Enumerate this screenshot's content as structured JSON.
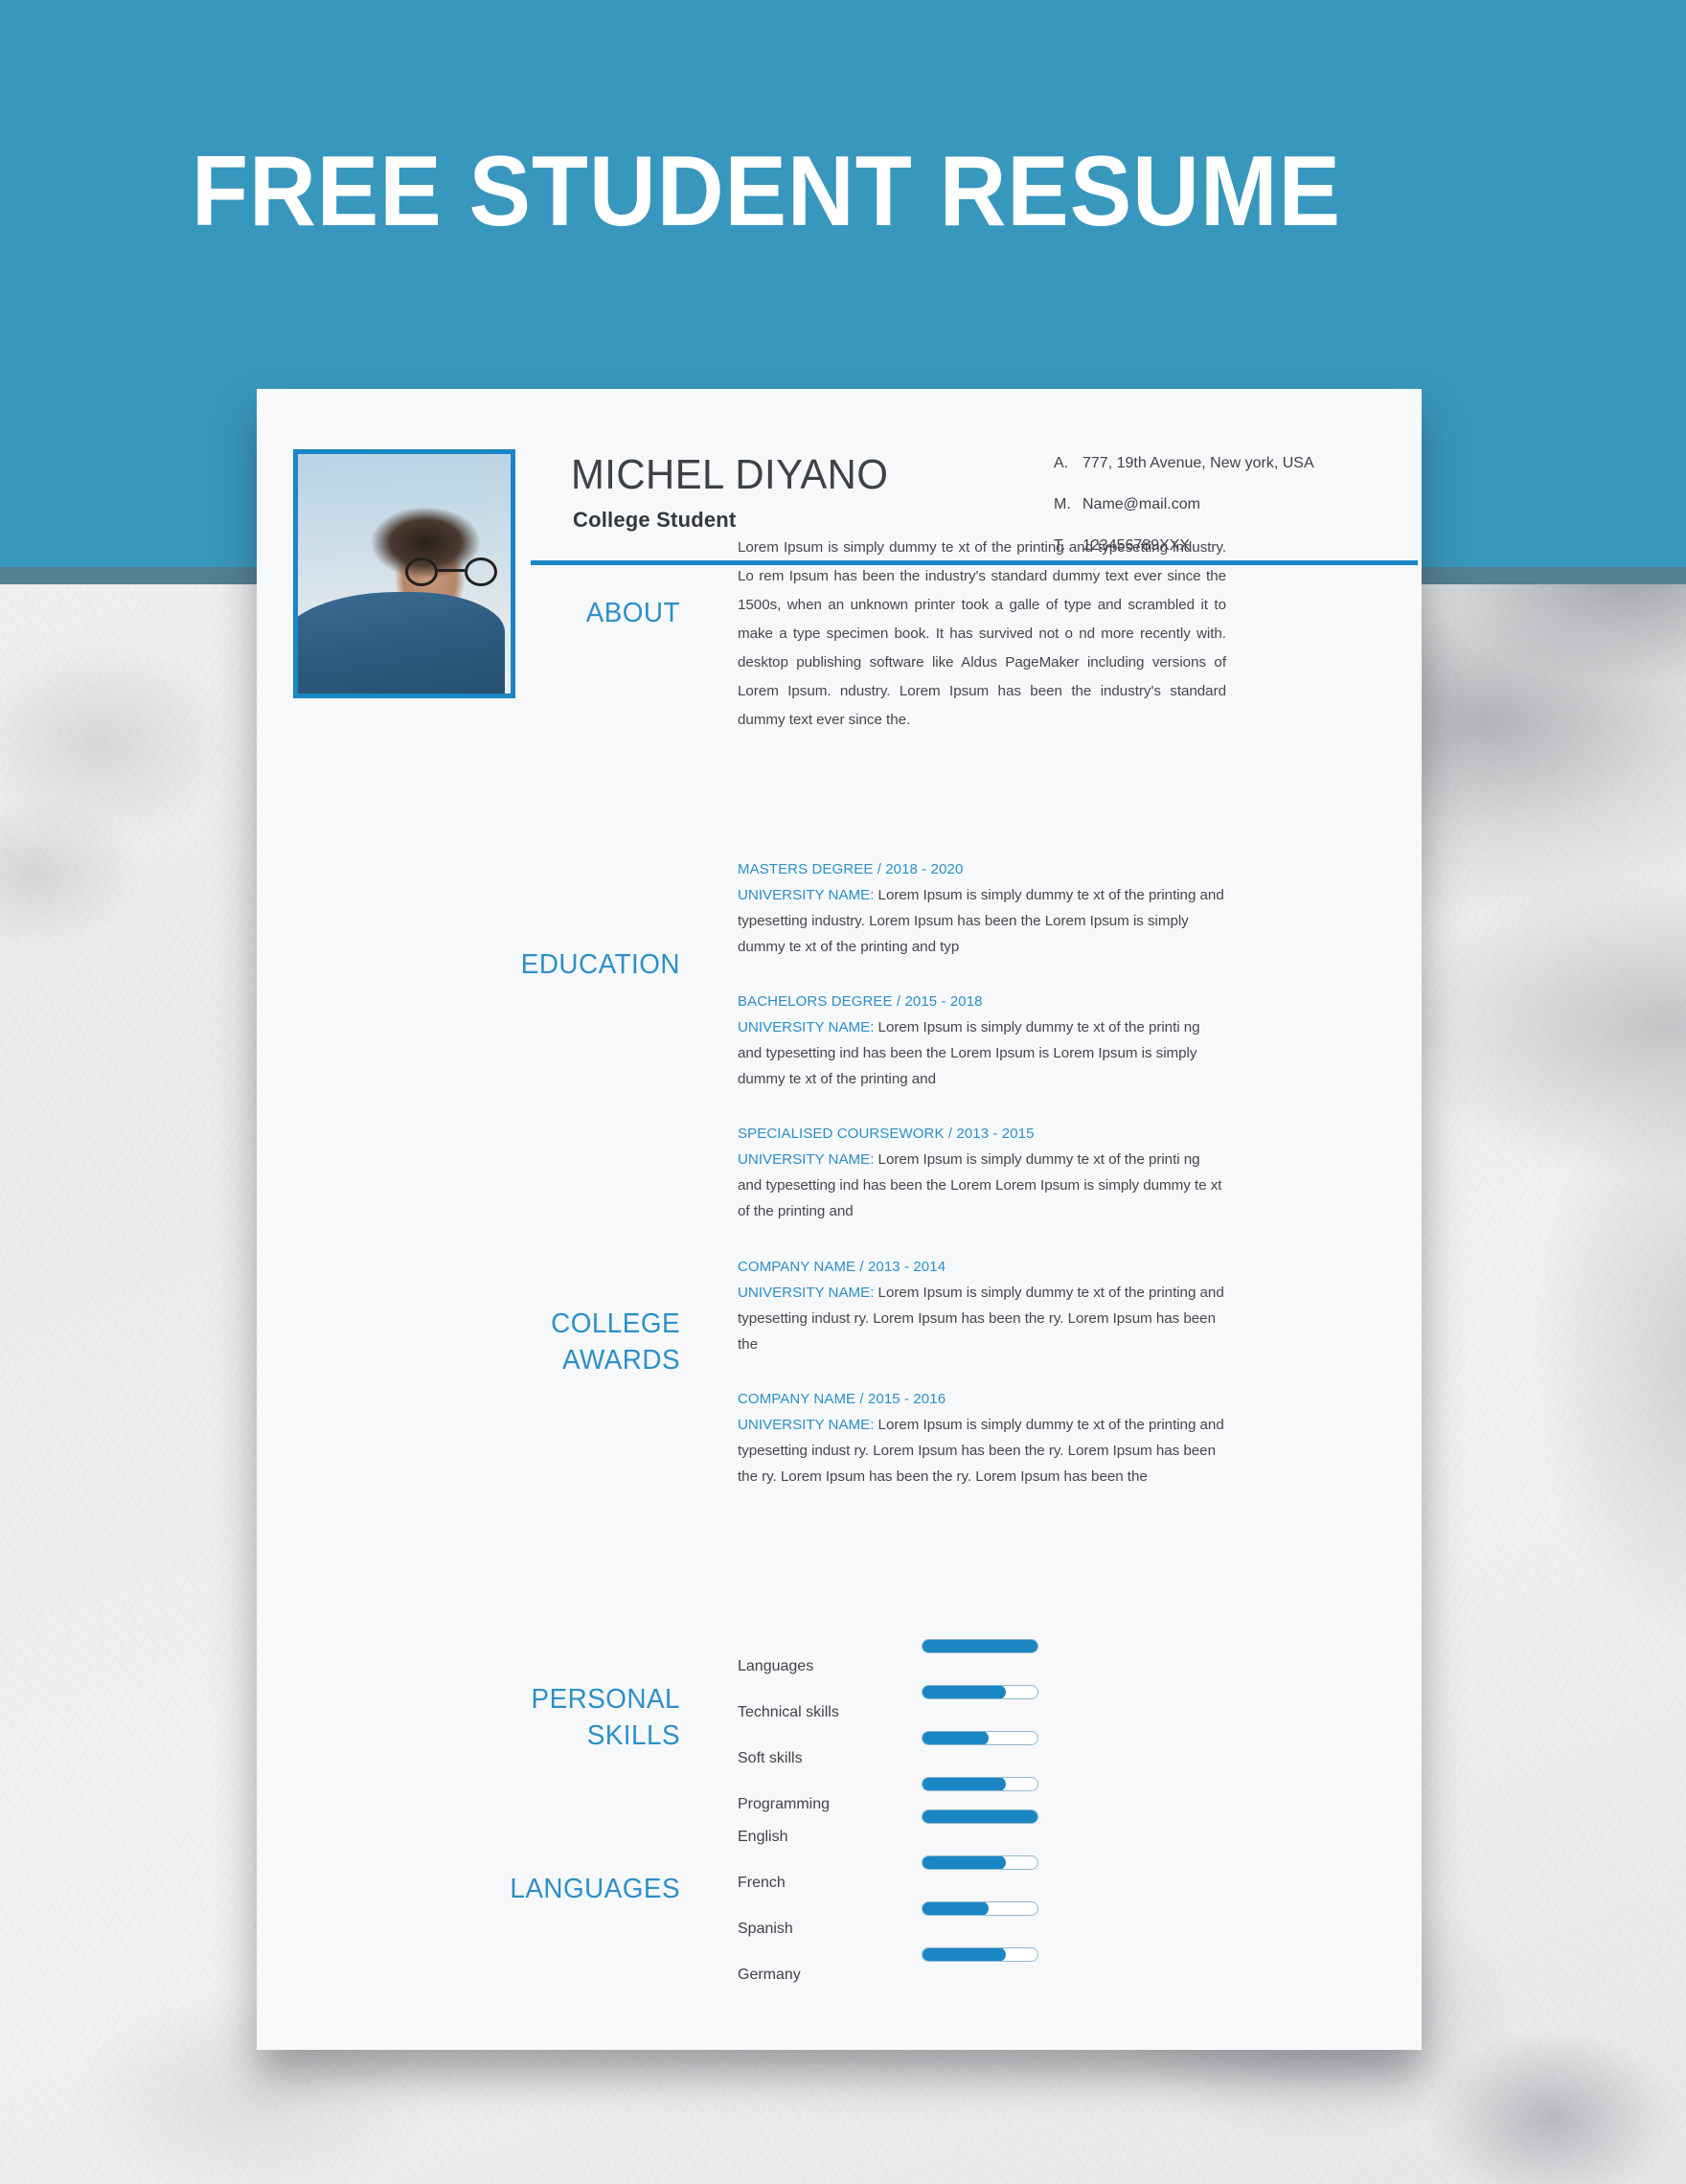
{
  "banner": {
    "title": "FREE STUDENT RESUME",
    "background_color": "#3897bd"
  },
  "theme": {
    "accent_blue": "#2c8fc9",
    "bar_blue": "#1a86c4",
    "sheet_background": "#f7f8f9",
    "body_text": "#44484c"
  },
  "resume": {
    "person": {
      "name": "MICHEL DIYANO",
      "role": "College Student"
    },
    "contact": [
      {
        "key": "A.",
        "value": "777, 19th Avenue, New york, USA"
      },
      {
        "key": "M.",
        "value": "Name@mail.com"
      },
      {
        "key": "T.",
        "value": "123456789XXX"
      }
    ],
    "about": {
      "title": "ABOUT",
      "text": "Lorem Ipsum is simply dummy te xt of the printing and typesetting industry. Lo rem Ipsum has been the industry's standard dummy text ever since the 1500s, when an unknown printer took a galle of type and scrambled it to make a type specimen book. It has survived not o nd more recently with. desktop publishing software like Aldus PageMaker including versions of Lorem Ipsum. ndustry. Lorem Ipsum has been the industry's standard dummy text ever since the."
    },
    "education": {
      "title": "EDUCATION",
      "entries": [
        {
          "heading": "MASTERS DEGREE / 2018 - 2020",
          "label": "UNIVERSITY NAME:",
          "text": " Lorem Ipsum is simply dummy te xt of the printing and typesetting industry. Lorem Ipsum has been the Lorem Ipsum is simply dummy te xt of the printing and typ"
        },
        {
          "heading": "BACHELORS DEGREE / 2015 - 2018",
          "label": "UNIVERSITY NAME:",
          "text": " Lorem Ipsum is simply dummy te xt of the printi ng and typesetting ind has been the Lorem Ipsum is Lorem Ipsum is simply dummy te xt of the printing and"
        },
        {
          "heading": "SPECIALISED COURSEWORK / 2013 - 2015",
          "label": "UNIVERSITY NAME:",
          "text": " Lorem Ipsum is simply dummy te xt of the printi ng and typesetting ind has been the Lorem Lorem Ipsum is simply dummy te xt of the printing and"
        }
      ]
    },
    "awards": {
      "title_line1": "COLLEGE",
      "title_line2": "AWARDS",
      "entries": [
        {
          "heading": "COMPANY NAME / 2013 - 2014",
          "label": "UNIVERSITY NAME:",
          "text": " Lorem Ipsum is simply dummy te xt of the printing and typesetting indust ry. Lorem Ipsum has been the ry. Lorem Ipsum has been the"
        },
        {
          "heading": "COMPANY NAME / 2015 - 2016",
          "label": "UNIVERSITY NAME:",
          "text": " Lorem Ipsum is simply dummy te xt of the printing and typesetting indust ry. Lorem Ipsum has been the ry. Lorem Ipsum has been the ry. Lorem Ipsum has been the ry. Lorem Ipsum has been the"
        }
      ]
    },
    "personal_skills": {
      "title_line1": "PERSONAL",
      "title_line2": "SKILLS",
      "items": [
        {
          "label": "Languages",
          "percent": 100
        },
        {
          "label": "Technical skills",
          "percent": 72
        },
        {
          "label": "Soft skills",
          "percent": 57
        },
        {
          "label": "Programming",
          "percent": 72
        }
      ]
    },
    "languages": {
      "title": "LANGUAGES",
      "items": [
        {
          "label": "English",
          "percent": 100
        },
        {
          "label": "French",
          "percent": 72
        },
        {
          "label": "Spanish",
          "percent": 57
        },
        {
          "label": "Germany",
          "percent": 72
        }
      ]
    }
  }
}
